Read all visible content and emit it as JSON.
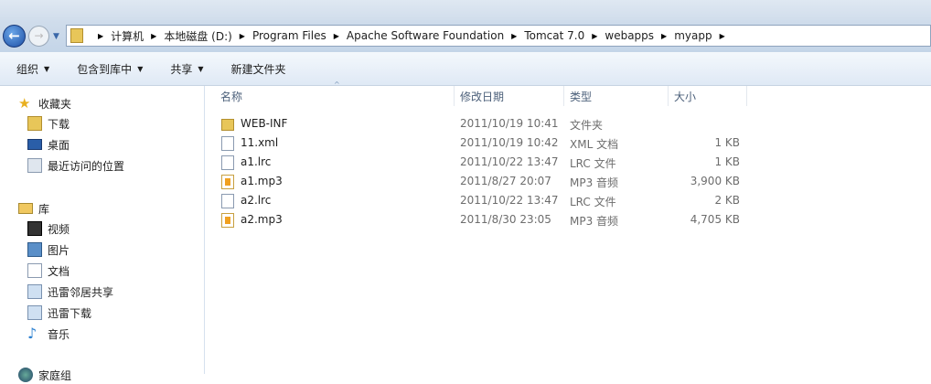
{
  "address": {
    "crumbs": [
      "计算机",
      "本地磁盘 (D:)",
      "Program Files",
      "Apache Software Foundation",
      "Tomcat 7.0",
      "webapps",
      "myapp"
    ]
  },
  "toolbar": {
    "organize": "组织",
    "include": "包含到库中",
    "share": "共享",
    "new_folder": "新建文件夹"
  },
  "nav": {
    "favorites": "收藏夹",
    "downloads": "下载",
    "desktop": "桌面",
    "recent": "最近访问的位置",
    "libraries": "库",
    "videos": "视频",
    "pictures": "图片",
    "documents": "文档",
    "xunlei_share": "迅雷邻居共享",
    "xunlei_download": "迅雷下载",
    "music": "音乐",
    "homegroup": "家庭组"
  },
  "columns": {
    "name": "名称",
    "date": "修改日期",
    "type": "类型",
    "size": "大小"
  },
  "files": [
    {
      "name": "WEB-INF",
      "date": "2011/10/19 10:41",
      "type": "文件夹",
      "size": "",
      "icon": "folder-icon"
    },
    {
      "name": "11.xml",
      "date": "2011/10/19 10:42",
      "type": "XML 文档",
      "size": "1 KB",
      "icon": "xml-file-icon"
    },
    {
      "name": "a1.lrc",
      "date": "2011/10/22 13:47",
      "type": "LRC 文件",
      "size": "1 KB",
      "icon": "file-icon"
    },
    {
      "name": "a1.mp3",
      "date": "2011/8/27 20:07",
      "type": "MP3 音频",
      "size": "3,900 KB",
      "icon": "audio-file-icon"
    },
    {
      "name": "a2.lrc",
      "date": "2011/10/22 13:47",
      "type": "LRC 文件",
      "size": "2 KB",
      "icon": "file-icon"
    },
    {
      "name": "a2.mp3",
      "date": "2011/8/30 23:05",
      "type": "MP3 音频",
      "size": "4,705 KB",
      "icon": "audio-file-icon"
    }
  ]
}
